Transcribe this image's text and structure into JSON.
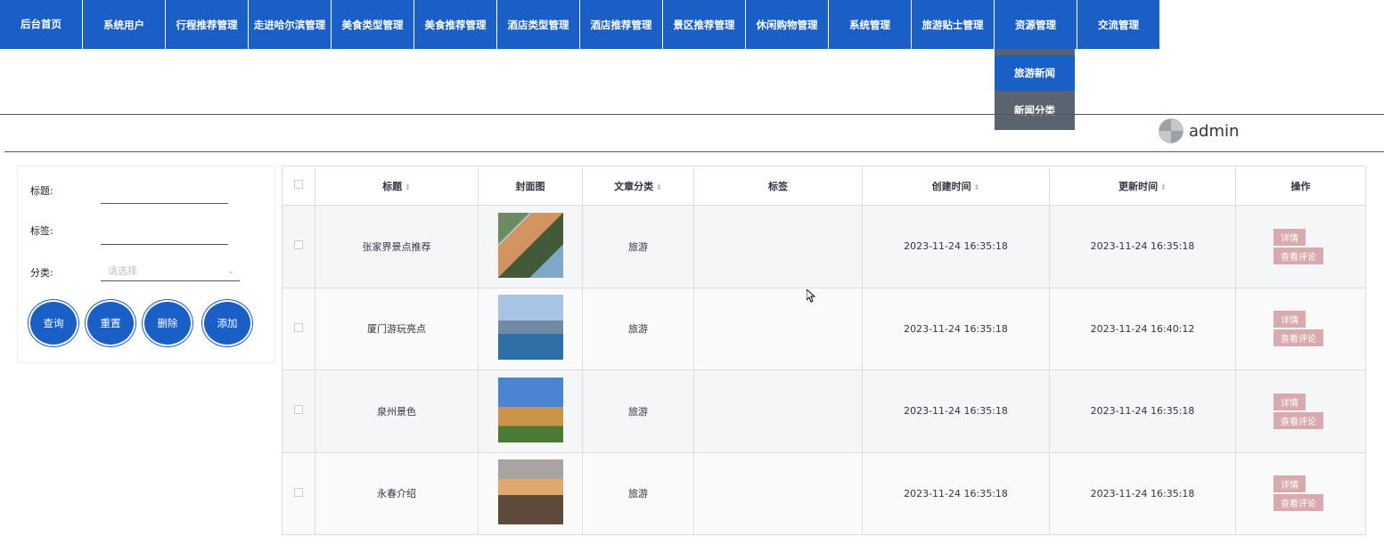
{
  "nav": {
    "items": [
      "后台首页",
      "系统用户",
      "行程推荐管理",
      "走进哈尔滨管理",
      "美食类型管理",
      "美食推荐管理",
      "酒店类型管理",
      "酒店推荐管理",
      "景区推荐管理",
      "休闲购物管理",
      "系统管理",
      "旅游贴士管理",
      "资源管理",
      "交流管理"
    ],
    "dropdown": [
      "旅游新闻",
      "新闻分类"
    ]
  },
  "user": {
    "name": "admin"
  },
  "search": {
    "title_label": "标题:",
    "tag_label": "标签:",
    "category_label": "分类:",
    "category_placeholder": "请选择",
    "buttons": [
      "查询",
      "重置",
      "删除",
      "添加"
    ]
  },
  "table": {
    "headers": [
      "标题",
      "封面图",
      "文章分类",
      "标签",
      "创建时间",
      "更新时间",
      "操作"
    ],
    "rows": [
      {
        "title": "张家界景点推荐",
        "category": "旅游",
        "tag": "",
        "created": "2023-11-24 16:35:18",
        "updated": "2023-11-24 16:35:18"
      },
      {
        "title": "厦门游玩亮点",
        "category": "旅游",
        "tag": "",
        "created": "2023-11-24 16:35:18",
        "updated": "2023-11-24 16:40:12"
      },
      {
        "title": "泉州景色",
        "category": "旅游",
        "tag": "",
        "created": "2023-11-24 16:35:18",
        "updated": "2023-11-24 16:35:18"
      },
      {
        "title": "永春介绍",
        "category": "旅游",
        "tag": "",
        "created": "2023-11-24 16:35:18",
        "updated": "2023-11-24 16:35:18"
      }
    ],
    "action_detail": "详情",
    "action_comments": "查看评论"
  },
  "colors": {
    "primary": "#1a5fc6",
    "dropdown_bg": "#5a6470",
    "action_btn": "#d9aaad"
  }
}
